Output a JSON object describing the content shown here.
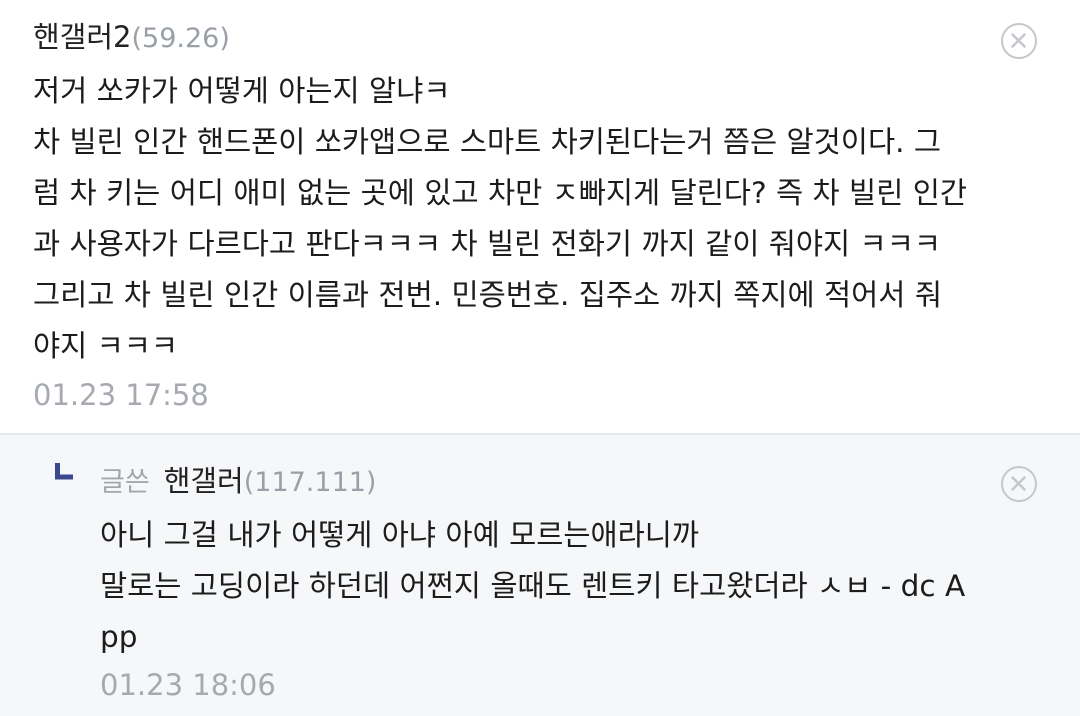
{
  "comment": {
    "nickname": "핸갤러2",
    "ip": "(59.26)",
    "body_lines": [
      "저거 쏘카가 어떻게 아는지 알냐ㅋ",
      "차 빌린 인간 핸드폰이 쏘카앱으로 스마트 차키된다는거 쯤은 알것이다. 그",
      "럼 차 키는 어디 애미 없는 곳에 있고 차만 ㅈ빠지게 달린다? 즉 차 빌린 인간",
      "과 사용자가 다르다고 판다ㅋㅋㅋ 차 빌린 전화기 까지 같이 줘야지 ㅋㅋㅋ",
      "그리고 차 빌린 인간 이름과 전번. 민증번호. 집주소 까지 쪽지에 적어서 줘",
      "야지 ㅋㅋㅋ"
    ],
    "timestamp": "01.23 17:58",
    "delete_icon": "close-circle-icon"
  },
  "reply": {
    "arrow_icon": "reply-arrow-icon",
    "writer_label": "글쓴",
    "nickname": "핸갤러",
    "ip": "(117.111)",
    "body_lines": [
      "아니 그걸 내가 어떻게 아냐 아예 모르는애라니까",
      "말로는 고딩이라 하던데 어쩐지 올때도 렌트키 타고왔더라 ㅅㅂ - dc A",
      "pp"
    ],
    "timestamp": "01.23 18:06",
    "delete_icon": "close-circle-icon"
  },
  "colors": {
    "reply_background": "#f6f7f9",
    "reply_arrow": "#3b4890",
    "meta_gray": "#a6aab0",
    "text": "#1c1c1c"
  }
}
